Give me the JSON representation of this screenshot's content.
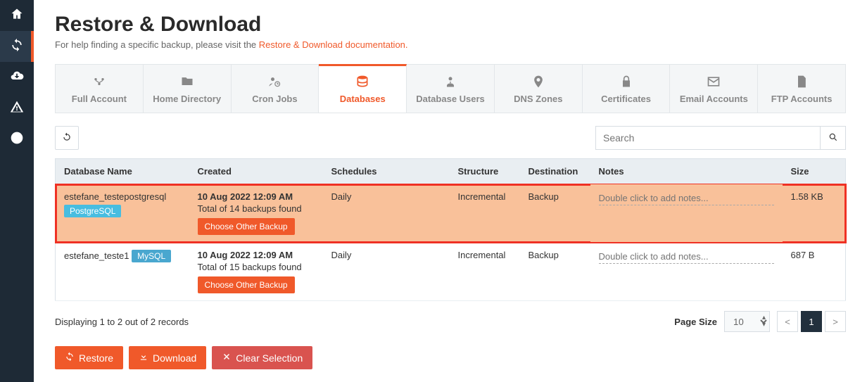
{
  "page": {
    "title": "Restore & Download",
    "subtitle_prefix": "For help finding a specific backup, please visit the ",
    "subtitle_link": "Restore & Download documentation."
  },
  "tabs": [
    {
      "label": "Full Account"
    },
    {
      "label": "Home Directory"
    },
    {
      "label": "Cron Jobs"
    },
    {
      "label": "Databases"
    },
    {
      "label": "Database Users"
    },
    {
      "label": "DNS Zones"
    },
    {
      "label": "Certificates"
    },
    {
      "label": "Email Accounts"
    },
    {
      "label": "FTP Accounts"
    }
  ],
  "search": {
    "placeholder": "Search"
  },
  "table": {
    "headers": {
      "name": "Database Name",
      "created": "Created",
      "schedules": "Schedules",
      "structure": "Structure",
      "destination": "Destination",
      "notes": "Notes",
      "size": "Size"
    },
    "rows": [
      {
        "name": "estefane_testepostgresql",
        "badge": "PostgreSQL",
        "created_date": "10 Aug 2022 12:09 AM",
        "created_sub": "Total of 14 backups found",
        "choose_label": "Choose Other Backup",
        "schedule": "Daily",
        "structure": "Incremental",
        "destination": "Backup",
        "notes_placeholder": "Double click to add notes...",
        "size": "1.58 KB"
      },
      {
        "name": "estefane_teste1",
        "badge": "MySQL",
        "created_date": "10 Aug 2022 12:09 AM",
        "created_sub": "Total of 15 backups found",
        "choose_label": "Choose Other Backup",
        "schedule": "Daily",
        "structure": "Incremental",
        "destination": "Backup",
        "notes_placeholder": "Double click to add notes...",
        "size": "687 B"
      }
    ]
  },
  "footer": {
    "displaying": "Displaying 1 to 2 out of 2 records",
    "page_size_label": "Page Size",
    "page_size_value": "10",
    "prev": "<",
    "current": "1",
    "next": ">"
  },
  "actions": {
    "restore": "Restore",
    "download": "Download",
    "clear": "Clear Selection"
  }
}
